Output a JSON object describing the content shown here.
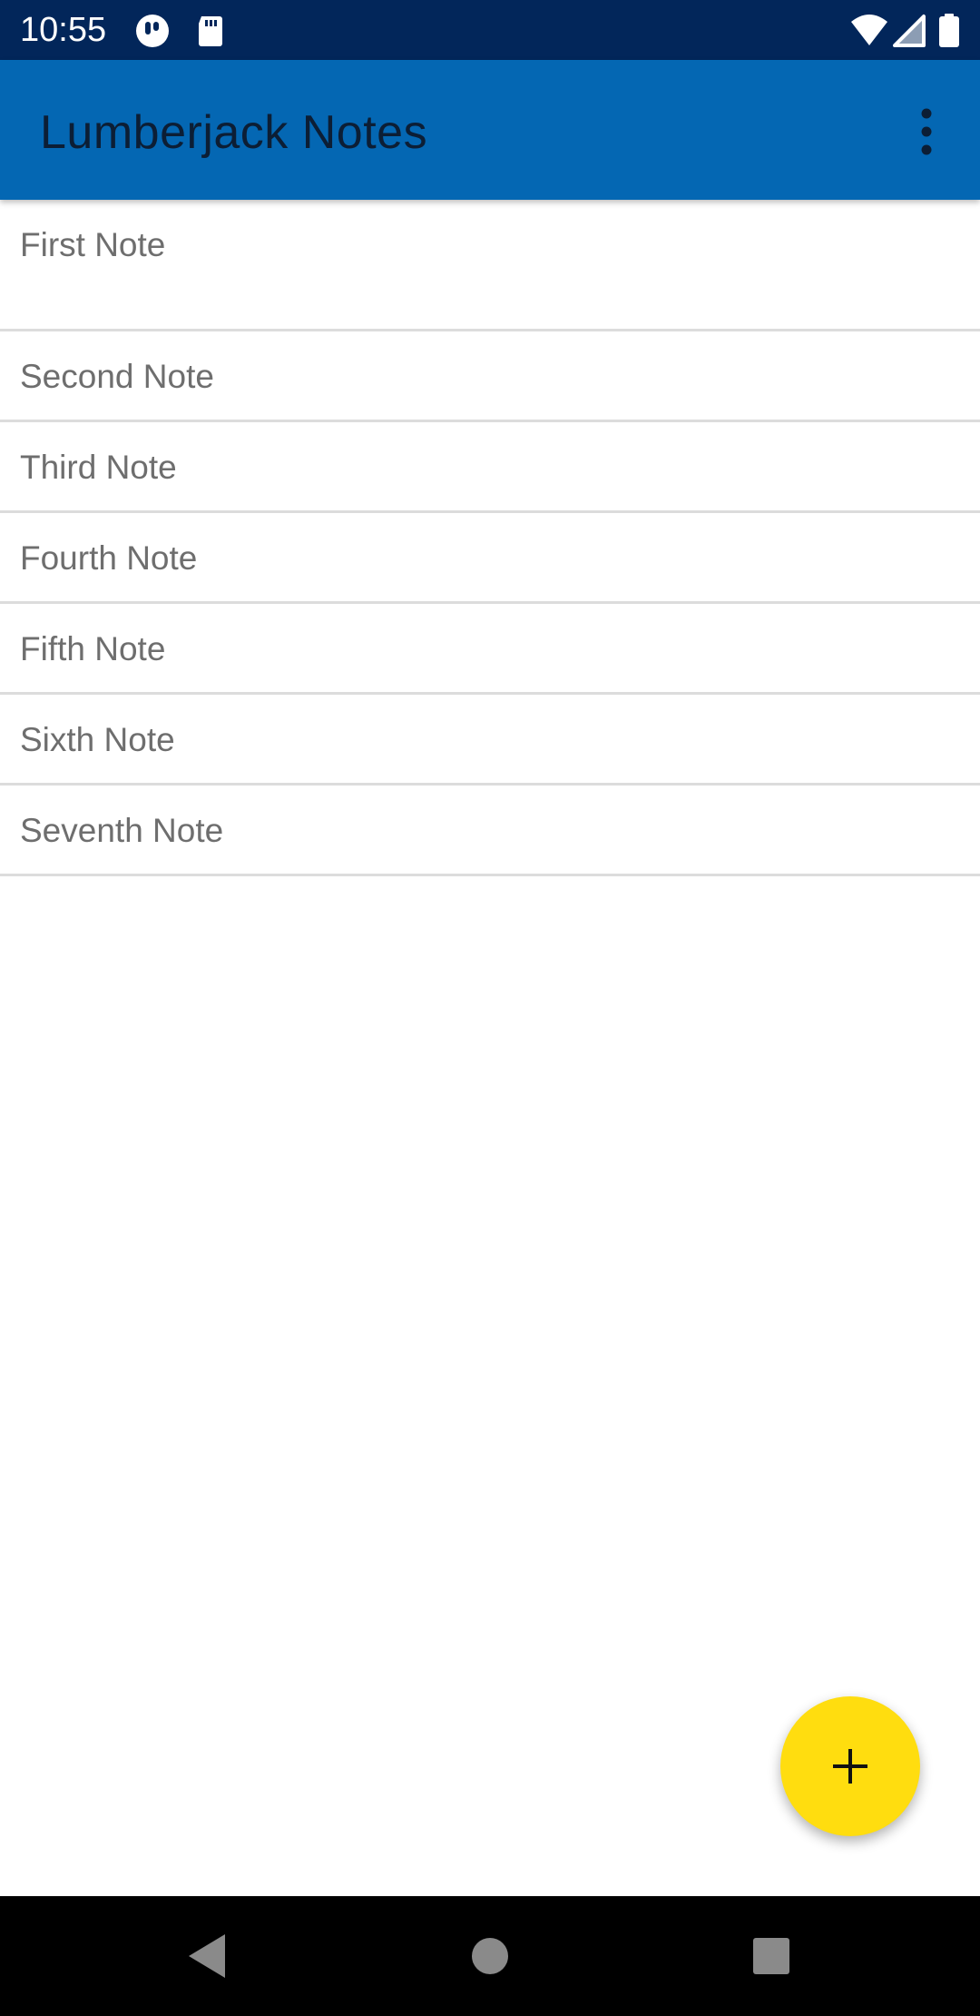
{
  "status_bar": {
    "time": "10:55",
    "background": "#02265a",
    "left_icons": [
      "notification-app-icon",
      "sd-card-icon"
    ],
    "right_icons": [
      "wifi-icon",
      "signal-icon",
      "battery-icon"
    ]
  },
  "app_bar": {
    "title": "Lumberjack Notes",
    "background": "#0467b3",
    "title_color": "#0c1e35",
    "overflow_icon": "more-vert-icon"
  },
  "notes": [
    {
      "title": "First Note"
    },
    {
      "title": "Second Note"
    },
    {
      "title": "Third Note"
    },
    {
      "title": "Fourth Note"
    },
    {
      "title": "Fifth Note"
    },
    {
      "title": "Sixth Note"
    },
    {
      "title": "Seventh Note"
    }
  ],
  "fab": {
    "icon": "plus-icon",
    "color": "#ffdd0f"
  },
  "nav_bar": {
    "buttons": [
      "back-icon",
      "home-icon",
      "recents-icon"
    ]
  }
}
